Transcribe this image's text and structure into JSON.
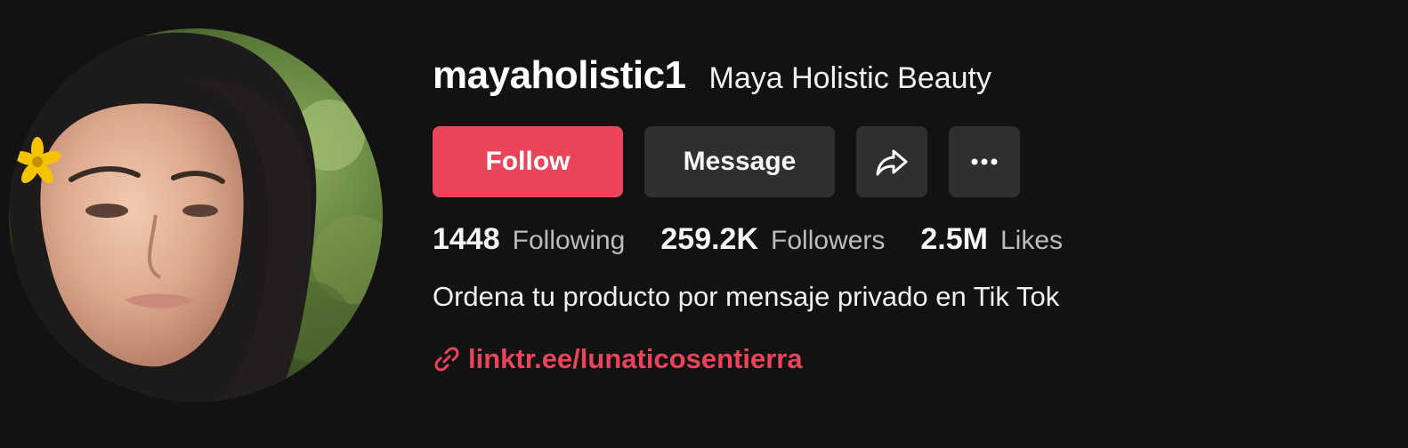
{
  "profile": {
    "username": "mayaholistic1",
    "display_name": "Maya Holistic Beauty",
    "avatar_alt": "Profile photo"
  },
  "buttons": {
    "follow": "Follow",
    "message": "Message",
    "share_icon": "share-arrow-icon",
    "more_icon": "more-dots-icon"
  },
  "stats": [
    {
      "value": "1448",
      "label": "Following"
    },
    {
      "value": "259.2K",
      "label": "Followers"
    },
    {
      "value": "2.5M",
      "label": "Likes"
    }
  ],
  "bio": "Ordena tu producto por mensaje privado en Tik Tok",
  "link": {
    "icon": "link-icon",
    "text": "linktr.ee/lunaticosentierra"
  },
  "colors": {
    "background": "#121212",
    "accent": "#ea445a",
    "button_secondary": "#2f2f2f"
  }
}
